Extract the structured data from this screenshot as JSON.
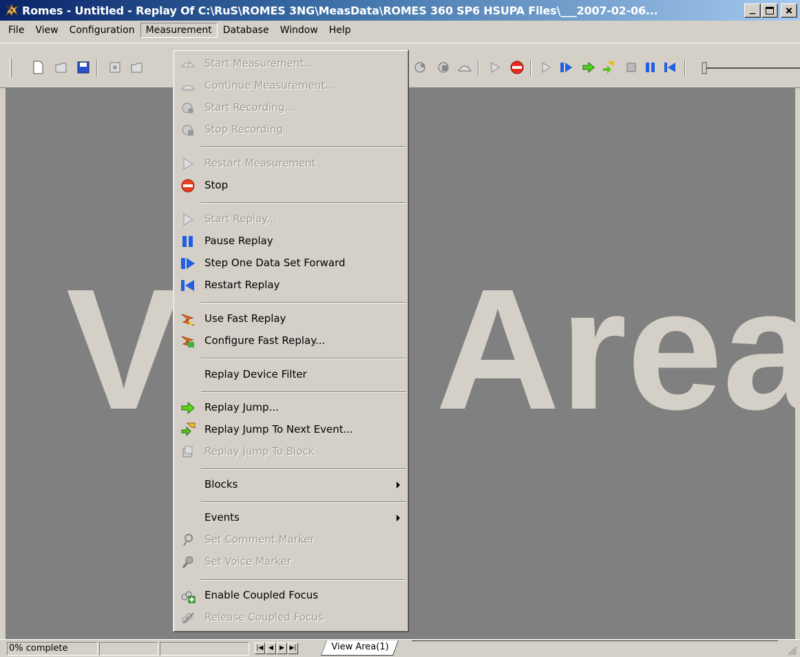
{
  "window": {
    "title": "Romes - Untitled - Replay Of C:\\RuS\\ROMES 3NG\\MeasData\\ROMES 360 SP6 HSUPA Files\\___2007-02-06...",
    "minimize_glyph": "_",
    "maximize_glyph": "□",
    "close_glyph": "×"
  },
  "menubar": {
    "items": [
      {
        "label": "File"
      },
      {
        "label": "View"
      },
      {
        "label": "Configuration"
      },
      {
        "label": "Measurement"
      },
      {
        "label": "Database"
      },
      {
        "label": "Window"
      },
      {
        "label": "Help"
      }
    ]
  },
  "measurement_menu": {
    "items": [
      {
        "label": "Start Measurement...",
        "enabled": false,
        "icon": "start-measurement-icon"
      },
      {
        "label": "Continue Measurement...",
        "enabled": false,
        "icon": "continue-measurement-icon"
      },
      {
        "label": "Start Recording...",
        "enabled": false,
        "icon": "start-recording-icon"
      },
      {
        "label": "Stop Recording",
        "enabled": false,
        "icon": "stop-recording-icon"
      },
      {
        "label": "Restart Measurement",
        "enabled": false,
        "icon": "play-icon"
      },
      {
        "label": "Stop",
        "enabled": true,
        "icon": "stop-icon"
      },
      {
        "label": "Start Replay...",
        "enabled": false,
        "icon": "play-icon"
      },
      {
        "label": "Pause Replay",
        "enabled": true,
        "icon": "pause-icon"
      },
      {
        "label": "Step One Data Set Forward",
        "enabled": true,
        "icon": "step-forward-icon"
      },
      {
        "label": "Restart Replay",
        "enabled": true,
        "icon": "rewind-icon"
      },
      {
        "label": "Use Fast Replay",
        "enabled": true,
        "icon": "fast-replay-icon"
      },
      {
        "label": "Configure Fast Replay...",
        "enabled": true,
        "icon": "configure-fast-replay-icon"
      },
      {
        "label": "Replay Device Filter",
        "enabled": true,
        "icon": ""
      },
      {
        "label": "Replay Jump...",
        "enabled": true,
        "icon": "green-arrow-icon"
      },
      {
        "label": "Replay Jump To Next Event...",
        "enabled": true,
        "icon": "jump-event-icon"
      },
      {
        "label": "Replay Jump To Block",
        "enabled": false,
        "icon": "jump-block-icon"
      },
      {
        "label": "Blocks",
        "enabled": true,
        "icon": "",
        "submenu": true
      },
      {
        "label": "Events",
        "enabled": true,
        "icon": "",
        "submenu": true
      },
      {
        "label": "Set Comment Marker",
        "enabled": false,
        "icon": "comment-marker-icon"
      },
      {
        "label": "Set Voice Marker",
        "enabled": false,
        "icon": "voice-marker-icon"
      },
      {
        "label": "Enable Coupled Focus",
        "enabled": true,
        "icon": "enable-coupled-focus-icon"
      },
      {
        "label": "Release Coupled Focus",
        "enabled": false,
        "icon": "release-coupled-focus-icon"
      }
    ]
  },
  "workspace": {
    "watermark_left": "V",
    "watermark_right": "Area"
  },
  "statusbar": {
    "progress_text": "0% complete",
    "progress_fraction": 0,
    "tab_label": "View Area(1)",
    "nav_first": "|◀",
    "nav_prev": "◀",
    "nav_next": "▶",
    "nav_last": "▶|"
  },
  "colors": {
    "workspace_bg": "#808080",
    "chrome": "#d4d0c8",
    "titlebar_start": "#0a246a",
    "watermark": "#d4d0c8",
    "disabled_text": "#a09c94"
  }
}
